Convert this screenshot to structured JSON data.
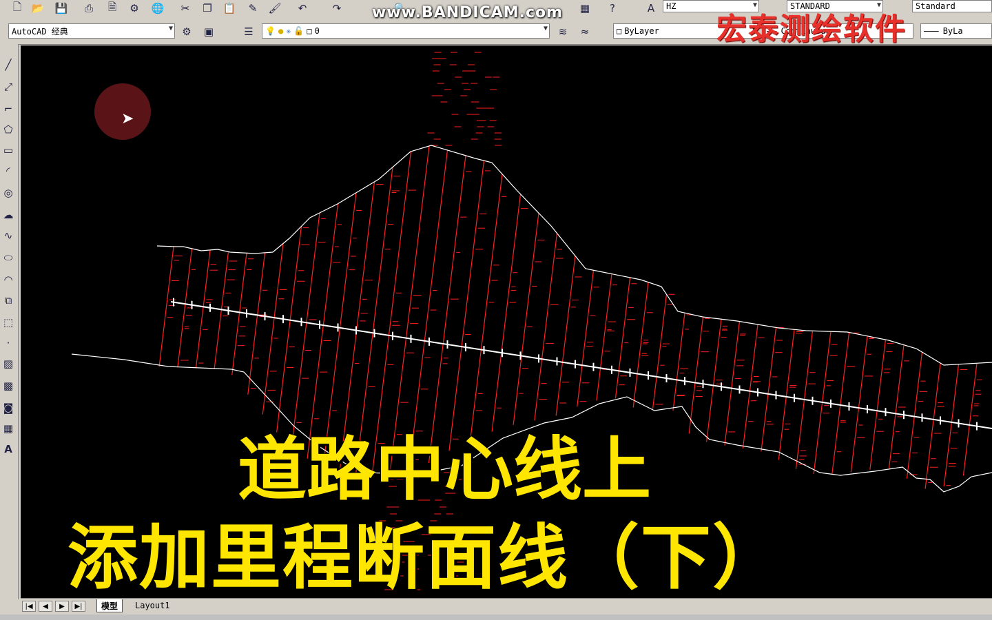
{
  "toolbar_top": {
    "icons": [
      "new-icon",
      "open-icon",
      "save-icon",
      "print-icon",
      "preview-icon",
      "publish-icon",
      "globe-icon",
      "cut-icon",
      "copy-icon",
      "paste-icon",
      "brush-icon",
      "match-icon",
      "undo-icon",
      "redo-icon",
      "zoom-icon",
      "calc-icon",
      "help-icon",
      "textstyle-icon"
    ],
    "text_style": "HZ",
    "dim_style": "STANDARD",
    "table_style": "Standard"
  },
  "toolbar_second": {
    "workspace": "AutoCAD 经典",
    "layer": "0",
    "color": "ByLayer",
    "linetype": "Continuous",
    "lineweight": "ByLa"
  },
  "watermark": "www.BANDICAM.com",
  "brand": "宏泰测绘软件",
  "caption": {
    "line1": "道路中心线上",
    "line2": "添加里程断面线（下）"
  },
  "tabs": {
    "model": "模型",
    "layout": "Layout1"
  },
  "draw_tools": [
    "line-icon",
    "xline-icon",
    "polyline-icon",
    "polygon-icon",
    "rectangle-icon",
    "arc-icon",
    "circle-icon",
    "revcloud-icon",
    "spline-icon",
    "ellipse-icon",
    "ellipse-arc-icon",
    "insert-block-icon",
    "make-block-icon",
    "point-icon",
    "hatch-icon",
    "gradient-icon",
    "region-icon",
    "table-icon",
    "mtext-icon"
  ],
  "colors": {
    "canvas": "#000000",
    "section": "#ff2020",
    "boundary": "#ffffff",
    "caption": "#ffe600",
    "brand": "#e8312a"
  }
}
